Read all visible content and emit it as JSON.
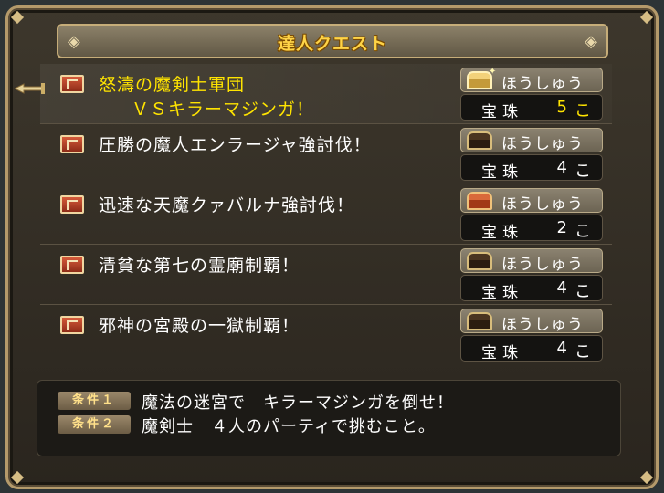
{
  "window": {
    "title": "達人クエスト"
  },
  "quests": [
    {
      "name_line1": "怒濤の魔剣士軍団",
      "name_line2": "ＶＳキラーマジンガ！",
      "reward_label": "ほうしゅう",
      "item": "宝珠",
      "qty": "5",
      "unit": "こ",
      "chest": "gold-chest-icon",
      "selected": true
    },
    {
      "name_line1": "圧勝の魔人エンラージャ強討伐！",
      "name_line2": "",
      "reward_label": "ほうしゅう",
      "item": "宝珠",
      "qty": "4",
      "unit": "こ",
      "chest": "dark-chest-icon",
      "selected": false
    },
    {
      "name_line1": "迅速な天魔クァバルナ強討伐！",
      "name_line2": "",
      "reward_label": "ほうしゅう",
      "item": "宝珠",
      "qty": "2",
      "unit": "こ",
      "chest": "red-chest-icon",
      "selected": false
    },
    {
      "name_line1": "清貧な第七の霊廟制覇！",
      "name_line2": "",
      "reward_label": "ほうしゅう",
      "item": "宝珠",
      "qty": "4",
      "unit": "こ",
      "chest": "dark-chest-icon",
      "selected": false
    },
    {
      "name_line1": "邪神の宮殿の一獄制覇！",
      "name_line2": "",
      "reward_label": "ほうしゅう",
      "item": "宝珠",
      "qty": "4",
      "unit": "こ",
      "chest": "dark-chest-icon",
      "selected": false
    }
  ],
  "conditions": [
    {
      "badge": "条件１",
      "text": "魔法の迷宮で　キラーマジンガを倒せ！"
    },
    {
      "badge": "条件２",
      "text": "魔剣士　４人のパーティで挑むこと。"
    }
  ],
  "colors": {
    "title": "#ffd447",
    "selected_text": "#ffe400",
    "frame_border": "#b49a6b"
  }
}
